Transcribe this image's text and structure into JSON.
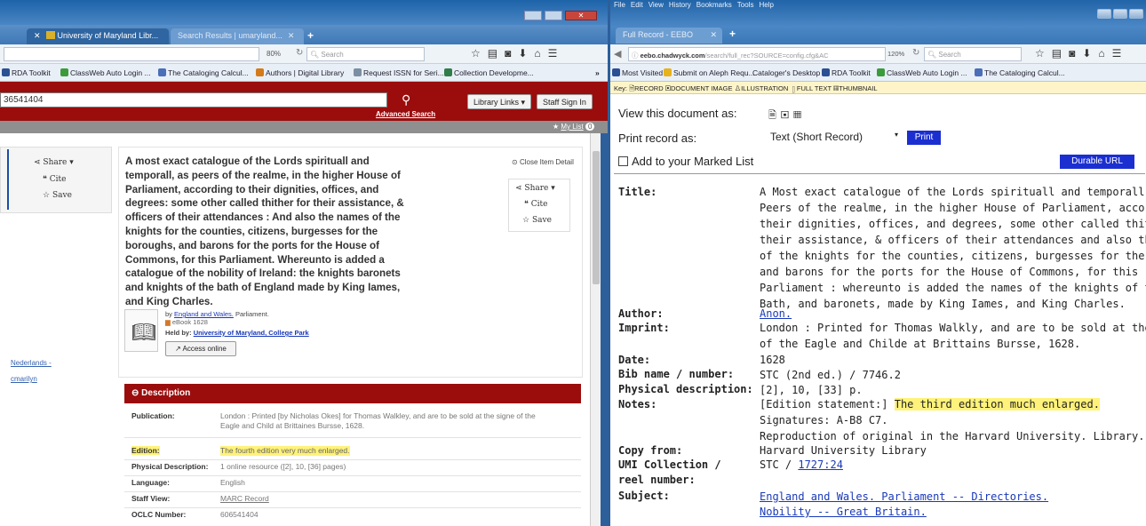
{
  "left_window": {
    "tabs": [
      "University of Maryland Libr...",
      "Search Results | umaryland..."
    ],
    "url": "",
    "zoom": "80%",
    "search_placeholder": "Search",
    "bookmarks": [
      "RDA Toolkit",
      "ClassWeb Auto Login ...",
      "The Cataloging Calcul...",
      "Authors | Digital Library",
      "Request ISSN for Seri...",
      "Collection Developme..."
    ],
    "search_value": "36541404",
    "advanced_search": "Advanced Search",
    "library_links": "Library Links",
    "staff_sign_in": "Staff Sign In",
    "my_list": "My List",
    "my_list_count": "0",
    "sidebar_actions": {
      "share": "Share",
      "cite": "Cite",
      "save": "Save"
    },
    "side_links": [
      "Nederlands -",
      "cmarilyn"
    ],
    "close_item_detail": "Close Item Detail",
    "title_lines": [
      "A most exact catalogue of the Lords spirituall and",
      "temporall, as peers of the realme, in the higher House of",
      "Parliament, according to their dignities, offices, and",
      "degrees: some other called thither for their assistance, &",
      "officers of their attendances : And also the names of the",
      "knights for the counties, citizens, burgesses for the",
      "boroughs, and barons for the ports for the House of",
      "Commons, for this Parliament. Whereunto is added a",
      "catalogue of the nobility of Ireland: the knights baronets",
      "and knights of the bath of England made by King Iames,",
      "and King Charles."
    ],
    "by_prefix": "by",
    "author_link": "England and Wales.",
    "author_suffix": "Parliament.",
    "format_line": "eBook 1628",
    "held_by_prefix": "Held by:",
    "held_by": "University of Maryland, College Park",
    "access_online": "Access online",
    "description_header": "Description",
    "description": [
      {
        "key": "Publication:",
        "line1": "London : Printed [by Nicholas Okes] for Thomas Walkley, and are to be sold at the signe of the",
        "line2": "Eagle and Child at Brittaines Bursse, 1628."
      },
      {
        "key": "Edition:",
        "line1": "The fourth edition very much enlarged.",
        "line2": ""
      },
      {
        "key": "Physical Description:",
        "line1": "1 online resource ([2], 10, [36] pages)",
        "line2": ""
      },
      {
        "key": "Language:",
        "line1": "English",
        "line2": ""
      },
      {
        "key": "Staff View:",
        "line1": "MARC Record",
        "line2": ""
      },
      {
        "key": "OCLC Number:",
        "line1": "606541404",
        "line2": ""
      }
    ]
  },
  "right_window": {
    "menu": [
      "File",
      "Edit",
      "View",
      "History",
      "Bookmarks",
      "Tools",
      "Help"
    ],
    "tab": "Full Record - EEBO",
    "url_host": "eebo.chadwyck.com",
    "url_path": "/search/full_rec?SOURCE=config.cfg&AC",
    "zoom": "120%",
    "search_placeholder": "Search",
    "bookmarks": [
      "Most Visited",
      "Submit on Aleph Requ...",
      "Cataloger's Desktop",
      "RDA Toolkit",
      "ClassWeb Auto Login ...",
      "The Cataloging Calcul..."
    ],
    "key_prefix": "Key:",
    "key_items": [
      "RECORD",
      "DOCUMENT IMAGE",
      "ILLUSTRATION",
      "FULL TEXT",
      "THUMBNAIL"
    ],
    "view_doc_label": "View this document as:",
    "print_label": "Print record as:",
    "print_select": "Text (Short Record)",
    "print_button": "Print",
    "add_marked": "Add to your Marked List",
    "durable_url": "Durable URL",
    "fields": {
      "title_label": "Title:",
      "title_lines": [
        "A Most exact catalogue of the Lords spirituall and temporall, as",
        "Peers of the realme, in the higher House of Parliament, according to",
        "their dignities, offices, and degrees, some other called thither for",
        "their assistance, & officers of their attendances and also the names",
        "of the knights for the counties, citizens, burgesses for the boroughs,",
        "and barons for the ports for the House of Commons, for this",
        "Parliament : whereunto is added the names of the knights of the",
        "Bath, and baronets, made by King Iames, and King Charles."
      ],
      "author_label": "Author:",
      "author": "Anon.",
      "imprint_label": "Imprint:",
      "imprint_lines": [
        "London : Printed for Thomas Walkly, and are to be sold at the signe",
        "of the Eagle and Childe at Brittains Bursse, 1628."
      ],
      "date_label": "Date:",
      "date": "1628",
      "bib_label": "Bib name / number:",
      "bib": "STC (2nd ed.) / 7746.2",
      "phys_label": "Physical description:",
      "phys": "[2], 10, [33] p.",
      "notes_label": "Notes:",
      "notes_prefix": "[Edition statement:]",
      "notes_edition": "The third edition much enlarged.",
      "notes_sig": "Signatures: A-B8 C7.",
      "notes_repro": "Reproduction of original in the Harvard University. Library.",
      "copy_label": "Copy from:",
      "copy": "Harvard University Library",
      "umi_label1": "UMI Collection /",
      "umi_label2": "reel number:",
      "umi_prefix": "STC /",
      "umi_reel": "1727:24",
      "subject_label": "Subject:",
      "subjects": [
        "England and Wales. Parliament -- Directories.",
        "Nobility -- Great Britain."
      ]
    }
  }
}
